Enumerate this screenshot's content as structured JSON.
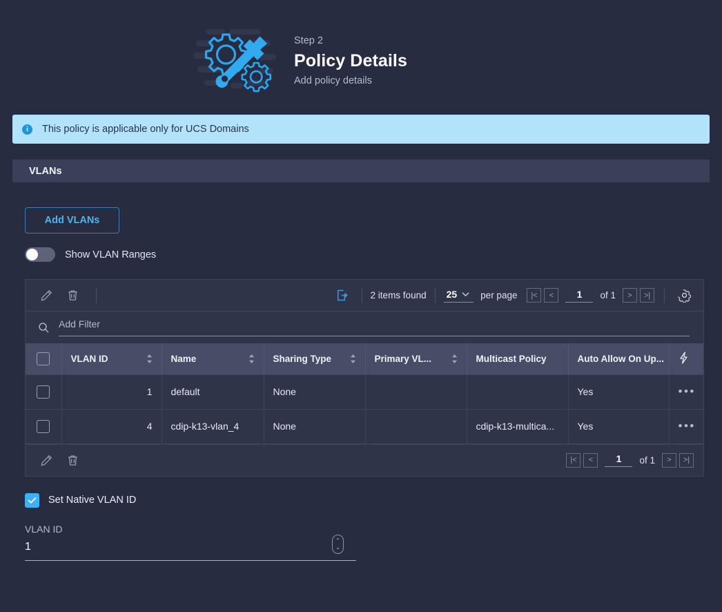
{
  "header": {
    "step_label": "Step 2",
    "title": "Policy Details",
    "subtitle": "Add policy details",
    "illustration": "gear-wrench-illustration"
  },
  "banner": {
    "icon": "info-icon",
    "glyph": "i",
    "text": "This policy is applicable only for UCS Domains",
    "bg_color": "#b3e3fb",
    "text_color": "#27334a"
  },
  "section": {
    "title": "VLANs"
  },
  "actions": {
    "add_vlans_label": "Add VLANs",
    "accent_color": "#4fb3f0"
  },
  "toggle": {
    "label": "Show VLAN Ranges",
    "state": "off"
  },
  "toolbar": {
    "edit_icon": "pencil-icon",
    "delete_icon": "trash-icon",
    "export_icon": "export-icon",
    "settings_icon": "gear-icon",
    "items_found": "2 items found",
    "per_page_value": "25",
    "per_page_label": "per page",
    "page_value": "1",
    "of_label": "of 1",
    "first_page": "|<",
    "prev_page": "<",
    "next_page": ">",
    "last_page": ">|"
  },
  "filter": {
    "icon": "search-icon",
    "placeholder": "Add Filter"
  },
  "table": {
    "columns": [
      {
        "label": "VLAN ID",
        "sortable": true
      },
      {
        "label": "Name",
        "sortable": true
      },
      {
        "label": "Sharing Type",
        "sortable": true
      },
      {
        "label": "Primary VL...",
        "sortable": true
      },
      {
        "label": "Multicast Policy",
        "sortable": false
      },
      {
        "label": "Auto Allow On Up...",
        "sortable": false
      }
    ],
    "action_header_icon": "lightning-icon",
    "rows": [
      {
        "vlan_id": "1",
        "name": "default",
        "sharing_type": "None",
        "primary_vlan": "",
        "multicast_policy": "",
        "auto_allow_on_uplinks": "Yes",
        "row_actions": "•••"
      },
      {
        "vlan_id": "4",
        "name": "cdip-k13-vlan_4",
        "sharing_type": "None",
        "primary_vlan": "",
        "multicast_policy": "cdip-k13-multica...",
        "auto_allow_on_uplinks": "Yes",
        "row_actions": "•••"
      }
    ]
  },
  "footer": {
    "edit_icon": "pencil-icon",
    "delete_icon": "trash-icon",
    "page_value": "1",
    "of_label": "of 1",
    "first_page": "|<",
    "prev_page": "<",
    "next_page": ">",
    "last_page": ">|"
  },
  "native_vlan": {
    "checkbox_label": "Set Native VLAN ID",
    "checked": true,
    "check_glyph": "✓",
    "field_label": "VLAN ID",
    "field_value": "1",
    "stepper_up": "⌃",
    "stepper_down": "⌄"
  },
  "theme": {
    "page_bg": "#272c40",
    "panel_bg": "#2f3449",
    "header_row_bg": "#474d66",
    "section_bar_bg": "#3a4059",
    "accent": "#4fb3f0"
  }
}
